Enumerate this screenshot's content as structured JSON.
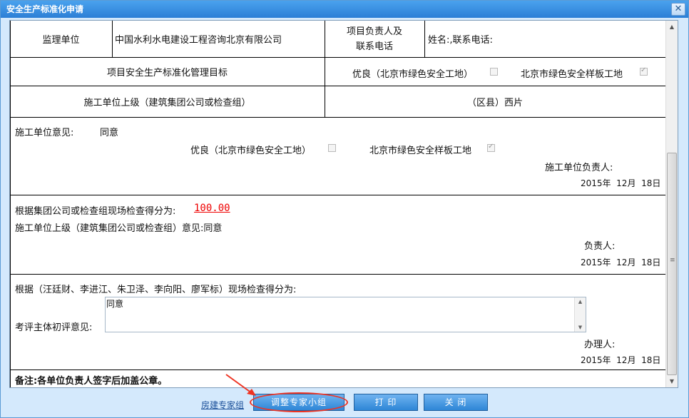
{
  "window": {
    "title": "安全生产标准化申请",
    "close_glyph": "✕"
  },
  "table": {
    "row1": {
      "supervisor_label": "监理单位",
      "supervisor_value": "中国水利水电建设工程咨询北京有限公司",
      "manager_label_1": "项目负责人及",
      "manager_label_2": "联系电话",
      "manager_value": "姓名:,联系电话:"
    },
    "row2": {
      "goal_label": "项目安全生产标准化管理目标",
      "option_excellent": "优良（北京市绿色安全工地）",
      "option_model": "北京市绿色安全样板工地",
      "excellent_checked": false,
      "model_checked": true
    },
    "row3": {
      "superior_label": "施工单位上级（建筑集团公司或检查组）",
      "district_value": "（区县）西片"
    }
  },
  "contractor_section": {
    "opinion_label": "施工单位意见:",
    "opinion_value": "同意",
    "option_excellent": "优良（北京市绿色安全工地）",
    "option_model": "北京市绿色安全样板工地",
    "excellent_checked": false,
    "model_checked": true,
    "signer_label": "施工单位负责人:",
    "date": "2015年  12月  18日"
  },
  "superior_section": {
    "score_label": "根据集团公司或检查组现场检查得分为:",
    "score_value": "100.00",
    "opinion_text": "施工单位上级（建筑集团公司或检查组）意见:同意",
    "signer_label": "负责人:",
    "date": "2015年  12月  18日"
  },
  "expert_section": {
    "score_text": "根据（汪廷财、李进江、朱卫泽、李向阳、廖军标）现场检查得分为:",
    "opinion_label": "考评主体初评意见:",
    "opinion_value": "同意",
    "signer_label": "办理人:",
    "date": "2015年  12月  18日"
  },
  "note": "备注:各单位负责人签字后加盖公章。",
  "footer": {
    "build_link": "房建专家组",
    "adjust_button": "调整专家小组",
    "print_button": "打 印",
    "close_button": "关 闭"
  },
  "colors": {
    "title_bar": "#2c7fd6",
    "button": "#2e86d6",
    "score": "#ee0000",
    "highlight": "#ee3322"
  }
}
